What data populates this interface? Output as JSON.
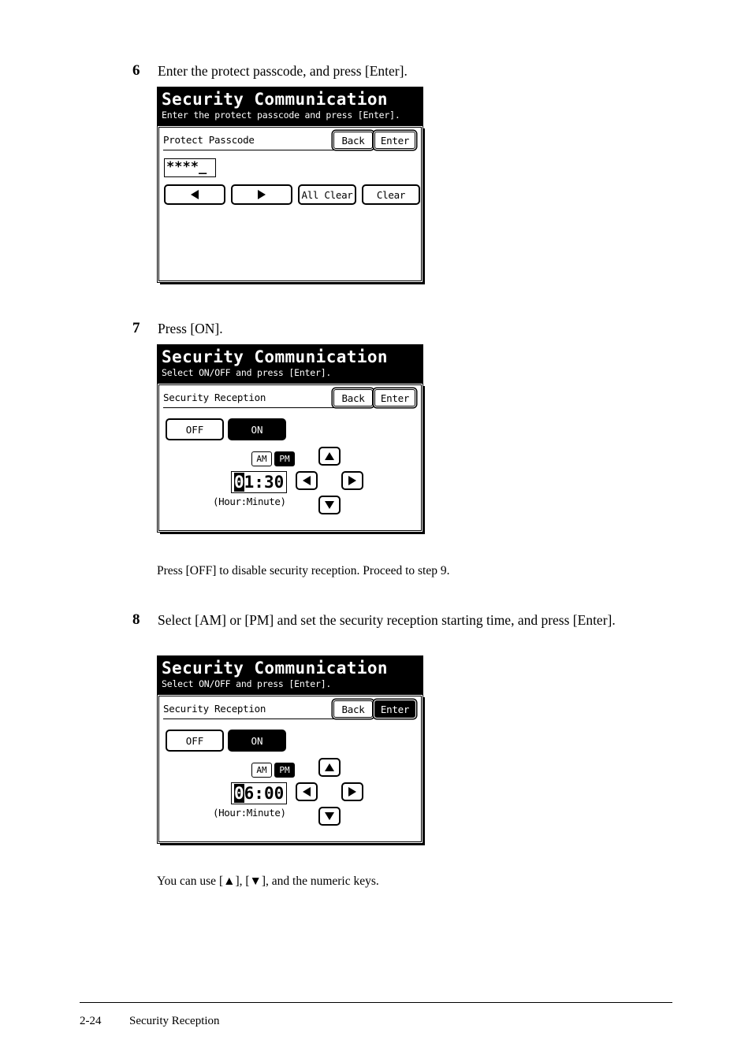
{
  "document": {
    "footer": {
      "page_number": "2-24",
      "section_title": "Security Reception"
    }
  },
  "steps": [
    {
      "number": "6",
      "instruction": "Enter the protect passcode, and press [Enter].",
      "panel": {
        "title": "Security Communication",
        "subtitle": "Enter the protect passcode and press [Enter].",
        "field_label": "Protect Passcode",
        "back_label": "Back",
        "enter_label": "Enter",
        "passcode_value": "****_",
        "keys": {
          "left_arrow": "◀",
          "right_arrow": "▶",
          "all_clear": "All Clear",
          "clear": "Clear"
        }
      }
    },
    {
      "number": "7",
      "instruction": "Press [ON].",
      "note": "Press [OFF] to disable security reception. Proceed to step 9.",
      "panel": {
        "title": "Security Communication",
        "subtitle": "Select ON/OFF and press [Enter].",
        "field_label": "Security Reception",
        "back_label": "Back",
        "enter_label": "Enter",
        "off_label": "OFF",
        "on_label": "ON",
        "am_label": "AM",
        "pm_label": "PM",
        "time_cursor_digit": "0",
        "time_rest": "1:30",
        "time_caption": "(Hour:Minute)"
      }
    },
    {
      "number": "8",
      "instruction": "Select [AM] or [PM] and set the security reception starting time, and press [Enter].",
      "note": "You can use [▲], [▼], and the numeric keys.",
      "panel": {
        "title": "Security Communication",
        "subtitle": "Select ON/OFF and press [Enter].",
        "field_label": "Security Reception",
        "back_label": "Back",
        "enter_label": "Enter",
        "off_label": "OFF",
        "on_label": "ON",
        "am_label": "AM",
        "pm_label": "PM",
        "time_cursor_digit": "0",
        "time_rest": "6:00",
        "time_caption": "(Hour:Minute)"
      }
    }
  ]
}
